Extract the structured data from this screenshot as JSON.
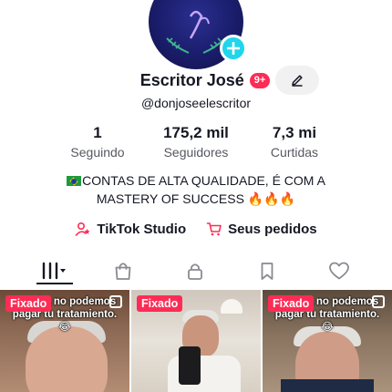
{
  "profile": {
    "display_name": "Escritor José",
    "notification_count": "9+",
    "username": "@donjoseelescritor"
  },
  "stats": [
    {
      "value": "1",
      "label": "Seguindo"
    },
    {
      "value": "175,2 mil",
      "label": "Seguidores"
    },
    {
      "value": "7,3 mi",
      "label": "Curtidas"
    }
  ],
  "bio": {
    "line1": "CONTAS DE ALTA QUALIDADE, É COM A",
    "line2": "MASTERY OF SUCCESS 🔥🔥🔥"
  },
  "links": {
    "studio": "TikTok Studio",
    "orders": "Seus pedidos"
  },
  "videos": [
    {
      "badge": "Fixado",
      "caption": "...r mio, no podemos pagar tu tratamiento. 😂"
    },
    {
      "badge": "Fixado",
      "caption": ""
    },
    {
      "badge": "Fixado",
      "caption": "...r mio, no podemos pagar tu tratamiento. 😂"
    }
  ],
  "colors": {
    "accent": "#fe2c55",
    "plus": "#20d5ec",
    "text": "#161823",
    "muted": "#565860"
  }
}
